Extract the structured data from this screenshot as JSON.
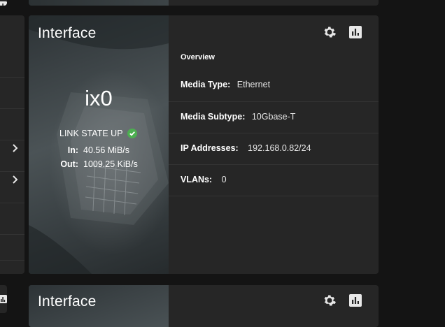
{
  "card": {
    "title": "Interface",
    "interface_name": "ix0",
    "link_state": "LINK STATE UP",
    "traffic": [
      {
        "label": "In:",
        "value": "40.56 MiB/s"
      },
      {
        "label": "Out:",
        "value": "1009.25 KiB/s"
      }
    ],
    "toolbar": {
      "settings_icon": "gear-icon",
      "stats_icon": "bar-chart-icon"
    },
    "overview": {
      "title": "Overview",
      "rows": [
        {
          "label": "Media Type:",
          "value": "Ethernet"
        },
        {
          "label": "Media Subtype:",
          "value": "10Gbase-T"
        },
        {
          "label": "IP Addresses:",
          "value": "192.168.0.82/24"
        },
        {
          "label": "VLANs:",
          "value": "0"
        }
      ]
    },
    "status_color": "#4caf50"
  },
  "next_card": {
    "title": "Interface"
  },
  "colors": {
    "background": "#141414",
    "card": "#262626",
    "divider": "#333333"
  }
}
